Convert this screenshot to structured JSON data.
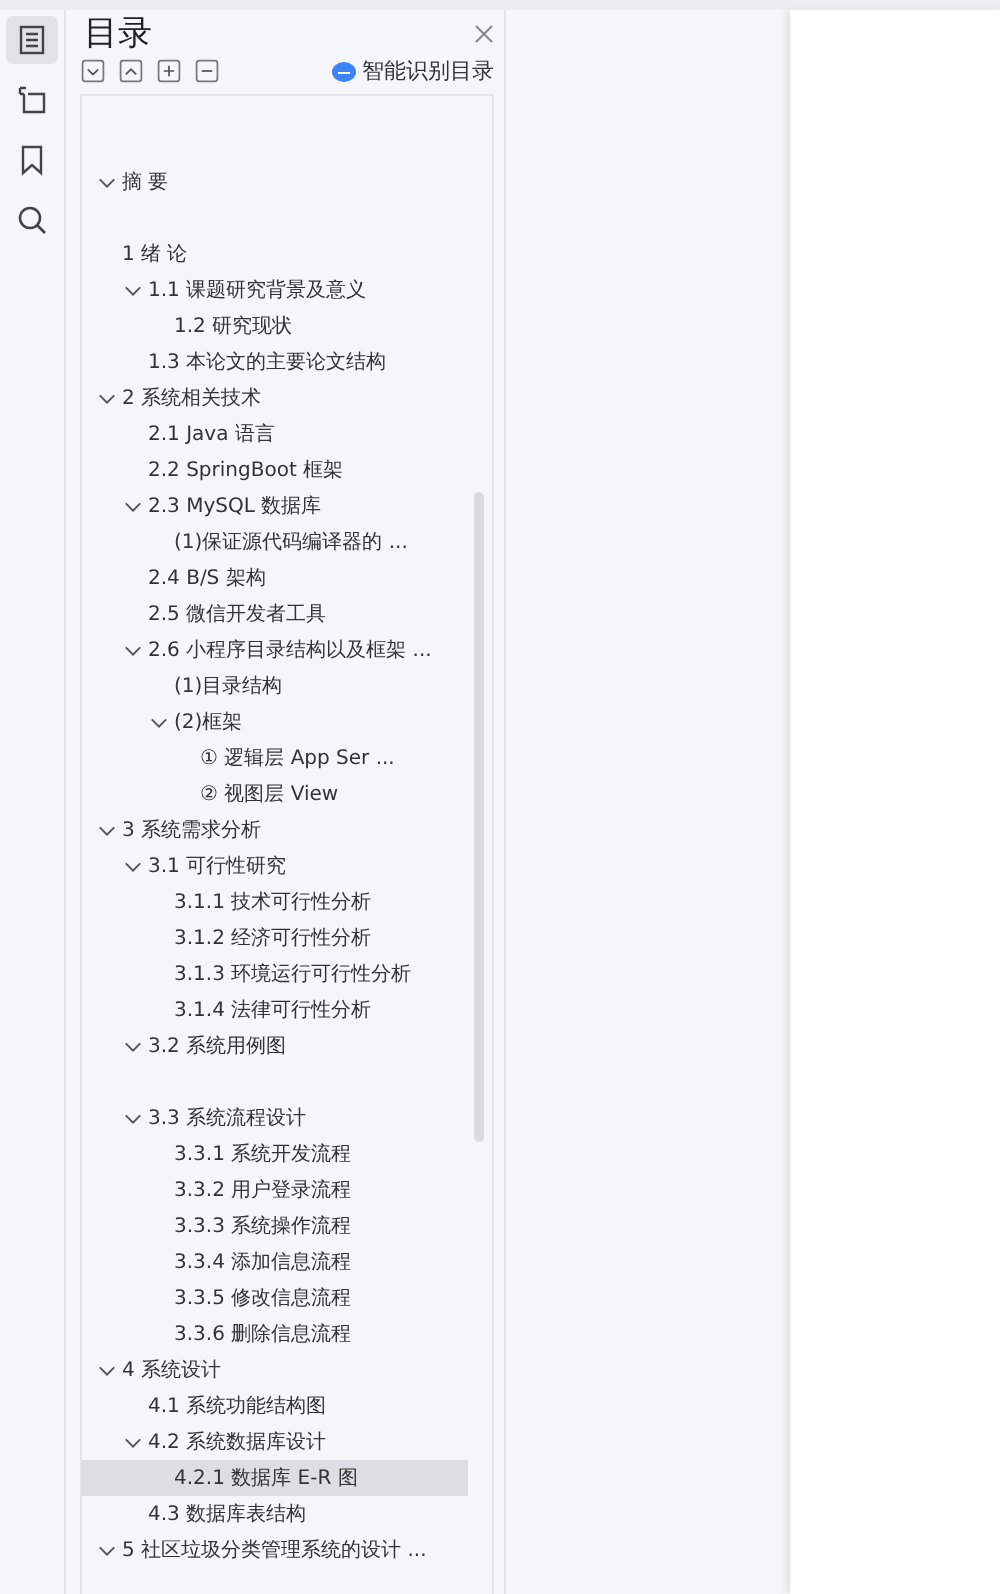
{
  "sidebar": {
    "items": [
      {
        "selected": true
      },
      {
        "selected": false
      },
      {
        "selected": false
      },
      {
        "selected": false
      }
    ]
  },
  "panel": {
    "title": "目录",
    "toolbar": [
      {
        "kind": "collapse"
      },
      {
        "kind": "expand"
      },
      {
        "kind": "plus"
      },
      {
        "kind": "minus"
      }
    ],
    "smart_button": "智能识别目录",
    "toc": [
      {
        "title": "摘  要",
        "expanded": true,
        "selected": false
      },
      {
        "title": "1 绪  论",
        "selected": false,
        "children": [
          {
            "title": "1.1 课题研究背景及意义",
            "expanded": true,
            "selected": false,
            "children": [
              {
                "title": "1.2 研究现状",
                "selected": false
              }
            ]
          },
          {
            "title": "1.3 本论文的主要论文结构",
            "selected": false
          }
        ]
      },
      {
        "title": "2 系统相关技术",
        "expanded": true,
        "selected": false,
        "children": [
          {
            "title": "2.1 Java 语言",
            "selected": false
          },
          {
            "title": "2.2 SpringBoot 框架",
            "selected": false
          },
          {
            "title": "2.3 MySQL 数据库",
            "expanded": true,
            "selected": false,
            "children": [
              {
                "title": "(1)保证源代码编译器的 ...",
                "selected": false
              }
            ]
          },
          {
            "title": "2.4 B/S 架构",
            "selected": false
          },
          {
            "title": "2.5  微信开发者工具",
            "selected": false
          },
          {
            "title": "2.6  小程序目录结构以及框架 ...",
            "expanded": true,
            "selected": false,
            "children": [
              {
                "title": "(1)目录结构",
                "selected": false
              },
              {
                "title": "(2)框架",
                "expanded": true,
                "selected": false,
                "children": [
                  {
                    "title": "①  逻辑层  App Ser ...",
                    "selected": false
                  },
                  {
                    "title": "②  视图层  View",
                    "selected": false
                  }
                ]
              }
            ]
          }
        ]
      },
      {
        "title": "3 系统需求分析",
        "expanded": true,
        "selected": false,
        "children": [
          {
            "title": "3.1 可行性研究",
            "expanded": true,
            "selected": false,
            "children": [
              {
                "title": "3.1.1 技术可行性分析",
                "selected": false
              },
              {
                "title": "3.1.2  经济可行性分析",
                "selected": false
              },
              {
                "title": "3.1.3  环境运行可行性分析",
                "selected": false
              },
              {
                "title": "3.1.4  法律可行性分析",
                "selected": false
              }
            ]
          },
          {
            "title": "3.2 系统用例图",
            "expanded": true,
            "selected": false
          },
          {
            "title": "3.3 系统流程设计",
            "expanded": true,
            "selected": false,
            "children": [
              {
                "title": "3.3.1  系统开发流程",
                "selected": false
              },
              {
                "title": "3.3.2  用户登录流程",
                "selected": false
              },
              {
                "title": "3.3.3  系统操作流程",
                "selected": false
              },
              {
                "title": "3.3.4  添加信息流程",
                "selected": false
              },
              {
                "title": "3.3.5  修改信息流程",
                "selected": false
              },
              {
                "title": "3.3.6  删除信息流程",
                "selected": false
              }
            ]
          }
        ]
      },
      {
        "title": "4 系统设计",
        "expanded": true,
        "selected": false,
        "children": [
          {
            "title": "4.1 系统功能结构图",
            "selected": false
          },
          {
            "title": "4.2 系统数据库设计",
            "expanded": true,
            "selected": false,
            "children": [
              {
                "title": "4.2.1 数据库 E-R 图",
                "selected": true
              }
            ]
          },
          {
            "title": "4.3 数据库表结构",
            "selected": false
          }
        ]
      },
      {
        "title": "5 社区垃圾分类管理系统的设计 ...",
        "expanded": true,
        "selected": false
      }
    ]
  }
}
